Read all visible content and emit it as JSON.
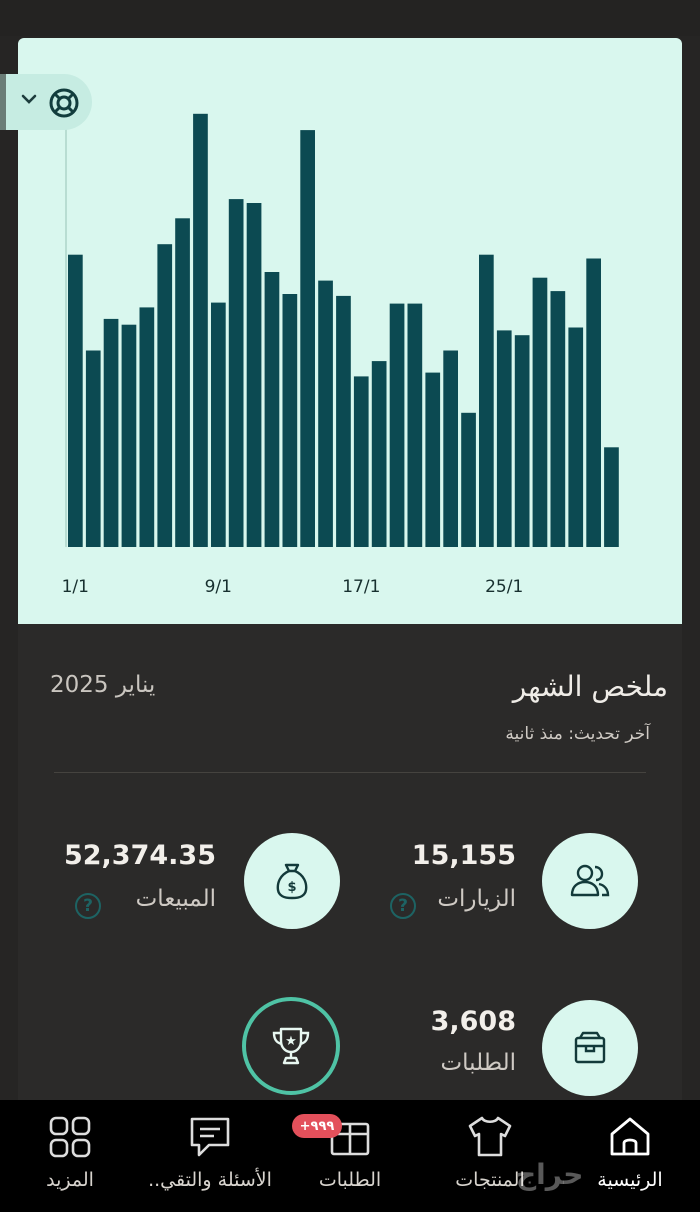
{
  "chart_data": {
    "type": "bar",
    "categories": [
      "1",
      "2",
      "3",
      "4",
      "5",
      "6",
      "7",
      "8",
      "9",
      "10",
      "11",
      "12",
      "13",
      "14",
      "15",
      "16",
      "17",
      "18",
      "19",
      "20",
      "21",
      "22",
      "23",
      "24",
      "25",
      "26",
      "27",
      "28",
      "29",
      "30",
      "31"
    ],
    "values": [
      305,
      205,
      238,
      232,
      250,
      316,
      343,
      452,
      255,
      363,
      359,
      287,
      264,
      435,
      278,
      262,
      178,
      194,
      254,
      254,
      182,
      205,
      140,
      305,
      226,
      221,
      281,
      267,
      229,
      301,
      104
    ],
    "x_tick_labels": [
      "1/1",
      "9/1",
      "17/1",
      "25/1"
    ],
    "x_tick_index": [
      0,
      8,
      16,
      24
    ],
    "ylim": [
      0,
      480
    ],
    "bar_color": "#0c4a52",
    "background": "#d9f7ee"
  },
  "summary": {
    "title": "ملخص الشهر",
    "month": "يناير 2025",
    "updated": "آخر تحديث: منذ ثانية"
  },
  "stats": {
    "visits": {
      "value": "15,155",
      "label": "الزيارات",
      "icon": "users-icon",
      "help": "?"
    },
    "sales": {
      "value": "52,374.35",
      "label": "المبيعات",
      "icon": "money-bag-icon",
      "help": "?"
    },
    "orders": {
      "value": "3,608",
      "label": "الطلبات",
      "icon": "box-icon"
    }
  },
  "nav": {
    "home": "الرئيسية",
    "products": "المنتجات",
    "orders": "الطلبات",
    "questions": "الأسئلة والتقي..",
    "more": "المزيد",
    "orders_badge": "+٩٩٩"
  },
  "watermark": "حراج",
  "colors": {
    "accent": "#d9f7ee",
    "bar": "#0c4a52",
    "ring": "#4fc3a5",
    "badge": "#e3505b"
  }
}
